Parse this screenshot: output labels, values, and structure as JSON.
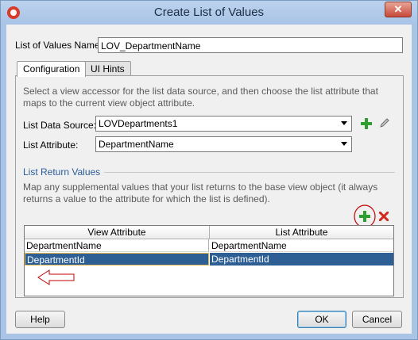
{
  "window": {
    "title": "Create List of Values"
  },
  "form": {
    "name_label": "List of Values Name:",
    "name_value": "LOV_DepartmentName"
  },
  "tabs": [
    {
      "label": "Configuration",
      "active": true
    },
    {
      "label": "UI Hints",
      "active": false
    }
  ],
  "config": {
    "description": "Select a view accessor for the list data source, and then choose the list attribute that maps to the current view object attribute.",
    "data_source_label": "List Data Source:",
    "data_source_value": "LOVDepartments1",
    "attribute_label": "List Attribute:",
    "attribute_value": "DepartmentName"
  },
  "return_values": {
    "section_title": "List Return Values",
    "description": "Map any supplemental values that your list returns to the base view object (it always returns a value to the attribute for which the list is defined).",
    "columns": [
      "View Attribute",
      "List Attribute"
    ],
    "rows": [
      {
        "view_attribute": "DepartmentName",
        "list_attribute": "DepartmentName",
        "selected": false
      },
      {
        "view_attribute": "DepartmentId",
        "list_attribute": "DepartmentId",
        "selected": true
      }
    ]
  },
  "buttons": {
    "help": "Help",
    "ok": "OK",
    "cancel": "Cancel"
  },
  "icons": {
    "app": "oracle-logo-icon",
    "close": "close-icon",
    "add": "green-plus-icon",
    "edit": "pencil-icon",
    "remove": "red-x-icon"
  },
  "colors": {
    "accent": "#2e5f94",
    "annotation": "#c00000",
    "add": "#2e9e2e",
    "remove": "#d22a1f"
  }
}
